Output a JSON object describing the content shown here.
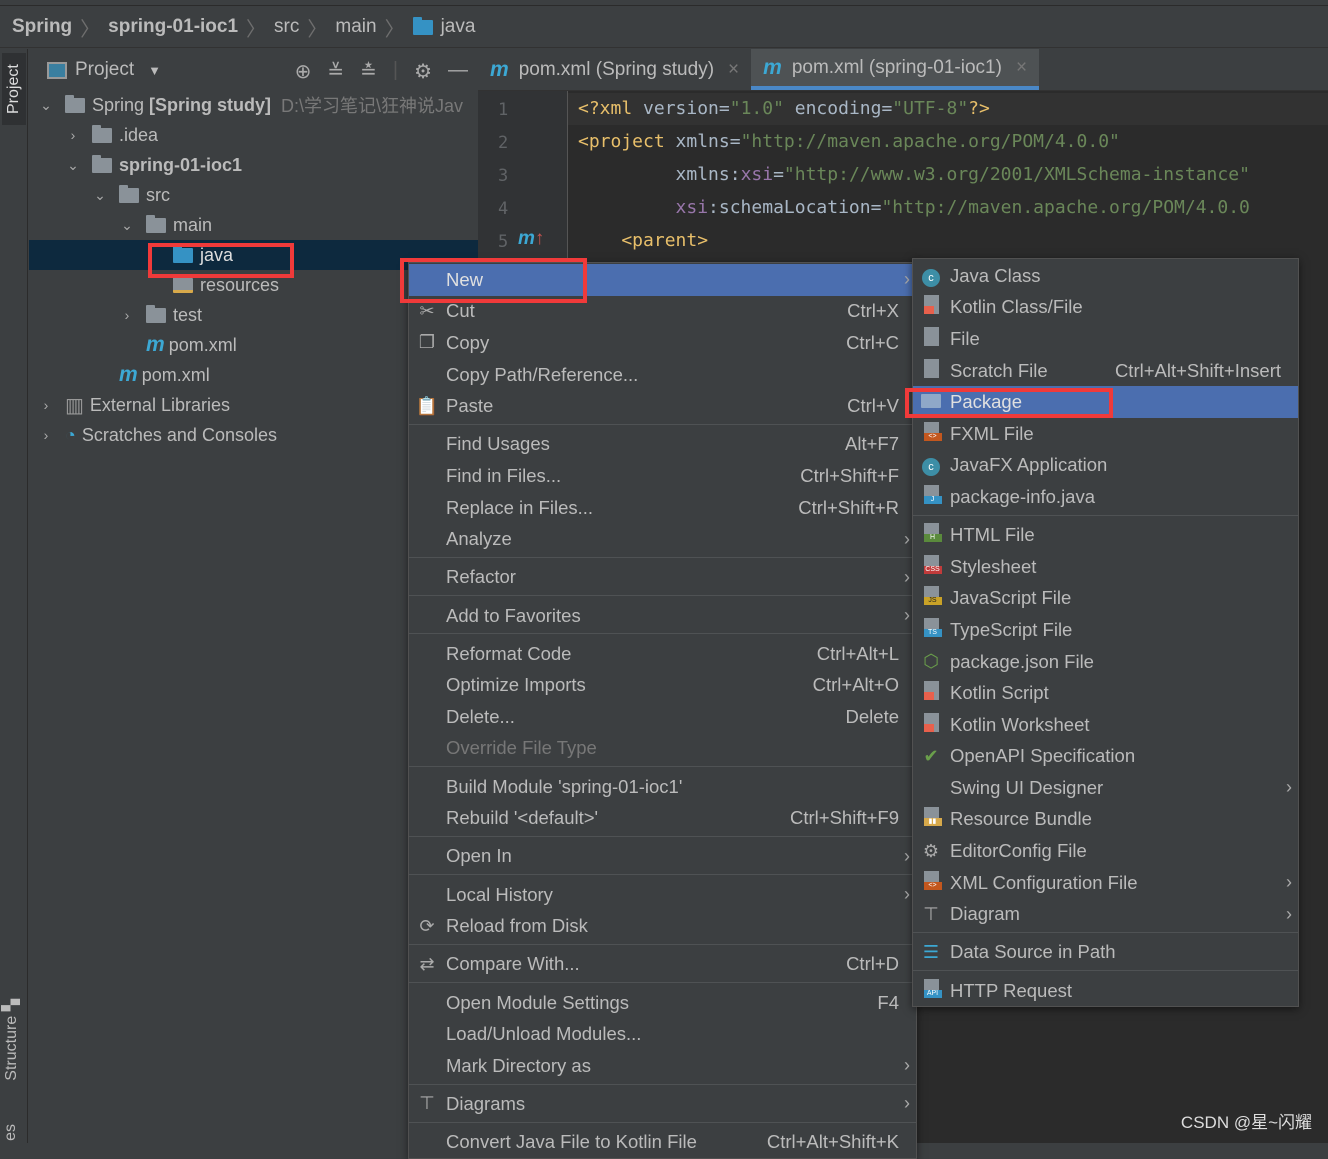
{
  "breadcrumb": [
    "Spring",
    "spring-01-ioc1",
    "src",
    "main",
    "java"
  ],
  "side_tabs": {
    "project": "Project",
    "structure": "Structure",
    "bottom": "es"
  },
  "panel": {
    "title": "Project",
    "toolbar_icons": [
      "locate-icon",
      "expand-all-icon",
      "collapse-all-icon",
      "gear-icon",
      "minimize-icon"
    ]
  },
  "tree": [
    {
      "label": "Spring",
      "bold": "[Spring study]",
      "path": "D:\\学习笔记\\狂神说Jav",
      "chev": "v",
      "icon": "module-folder",
      "indent": 0
    },
    {
      "label": ".idea",
      "chev": ">",
      "icon": "folder",
      "indent": 1
    },
    {
      "label": "spring-01-ioc1",
      "chev": "v",
      "icon": "module-folder",
      "indent": 1,
      "bold_label": true
    },
    {
      "label": "src",
      "chev": "v",
      "icon": "folder",
      "indent": 2
    },
    {
      "label": "main",
      "chev": "v",
      "icon": "folder",
      "indent": 3
    },
    {
      "label": "java",
      "icon": "source-folder",
      "indent": 4,
      "selected": true
    },
    {
      "label": "resources",
      "icon": "resources-folder",
      "indent": 4
    },
    {
      "label": "test",
      "chev": ">",
      "icon": "folder",
      "indent": 3
    },
    {
      "label": "pom.xml",
      "icon": "maven",
      "indent": 3
    },
    {
      "label": "pom.xml",
      "icon": "maven",
      "indent": 2
    },
    {
      "label": "External Libraries",
      "chev": ">",
      "icon": "libraries",
      "indent": 0
    },
    {
      "label": "Scratches and Consoles",
      "chev": ">",
      "icon": "scratches",
      "indent": 0
    }
  ],
  "editor": {
    "tabs": [
      {
        "label": "pom.xml (Spring study)",
        "active": false
      },
      {
        "label": "pom.xml (spring-01-ioc1)",
        "active": true
      }
    ],
    "line_numbers": [
      "1",
      "2",
      "3",
      "4",
      "5"
    ],
    "lines": [
      [
        [
          "t",
          "<?xml "
        ],
        [
          "a",
          "version="
        ],
        [
          "s",
          "\"1.0\""
        ],
        [
          "a",
          " encoding="
        ],
        [
          "s",
          "\"UTF-8\""
        ],
        [
          "t",
          "?>"
        ]
      ],
      [
        [
          "t",
          "<project "
        ],
        [
          "a",
          "xmlns="
        ],
        [
          "s",
          "\"http://maven.apache.org/POM/4.0.0\""
        ]
      ],
      [
        [
          "a",
          "         xmlns:"
        ],
        [
          "n",
          "xsi"
        ],
        [
          "a",
          "="
        ],
        [
          "s",
          "\"http://www.w3.org/2001/XMLSchema-instance\""
        ]
      ],
      [
        [
          "n",
          "         xsi"
        ],
        [
          "a",
          ":schemaLocation="
        ],
        [
          "s",
          "\"http://maven.apache.org/POM/4.0.0"
        ]
      ],
      [
        [
          "t",
          "    <parent>"
        ]
      ]
    ]
  },
  "context_menu": [
    {
      "label": "New",
      "arrow": true,
      "highlight": true
    },
    {
      "label": "Cut",
      "shortcut": "Ctrl+X",
      "icon": "cut-icon"
    },
    {
      "label": "Copy",
      "shortcut": "Ctrl+C",
      "icon": "copy-icon"
    },
    {
      "label": "Copy Path/Reference..."
    },
    {
      "label": "Paste",
      "shortcut": "Ctrl+V",
      "icon": "paste-icon"
    },
    {
      "sep": true
    },
    {
      "label": "Find Usages",
      "shortcut": "Alt+F7"
    },
    {
      "label": "Find in Files...",
      "shortcut": "Ctrl+Shift+F"
    },
    {
      "label": "Replace in Files...",
      "shortcut": "Ctrl+Shift+R"
    },
    {
      "label": "Analyze",
      "arrow": true
    },
    {
      "sep": true
    },
    {
      "label": "Refactor",
      "arrow": true
    },
    {
      "sep": true
    },
    {
      "label": "Add to Favorites",
      "arrow": true
    },
    {
      "sep": true
    },
    {
      "label": "Reformat Code",
      "shortcut": "Ctrl+Alt+L"
    },
    {
      "label": "Optimize Imports",
      "shortcut": "Ctrl+Alt+O"
    },
    {
      "label": "Delete...",
      "shortcut": "Delete"
    },
    {
      "label": "Override File Type",
      "disabled": true
    },
    {
      "sep": true
    },
    {
      "label": "Build Module 'spring-01-ioc1'"
    },
    {
      "label": "Rebuild '<default>'",
      "shortcut": "Ctrl+Shift+F9"
    },
    {
      "sep": true
    },
    {
      "label": "Open In",
      "arrow": true
    },
    {
      "sep": true
    },
    {
      "label": "Local History",
      "arrow": true
    },
    {
      "label": "Reload from Disk",
      "icon": "reload-icon"
    },
    {
      "sep": true
    },
    {
      "label": "Compare With...",
      "shortcut": "Ctrl+D",
      "icon": "compare-icon"
    },
    {
      "sep": true
    },
    {
      "label": "Open Module Settings",
      "shortcut": "F4"
    },
    {
      "label": "Load/Unload Modules..."
    },
    {
      "label": "Mark Directory as",
      "arrow": true
    },
    {
      "sep": true
    },
    {
      "label": "Diagrams",
      "arrow": true,
      "icon": "diagram-icon"
    },
    {
      "sep": true
    },
    {
      "label": "Convert Java File to Kotlin File",
      "shortcut": "Ctrl+Alt+Shift+K"
    }
  ],
  "new_submenu": [
    {
      "label": "Java Class",
      "icon": "java-class-icon"
    },
    {
      "label": "Kotlin Class/File",
      "icon": "kotlin-file-icon"
    },
    {
      "label": "File",
      "icon": "file-icon"
    },
    {
      "label": "Scratch File",
      "shortcut": "Ctrl+Alt+Shift+Insert",
      "icon": "scratch-file-icon"
    },
    {
      "label": "Package",
      "icon": "package-icon",
      "highlight": true
    },
    {
      "label": "FXML File",
      "icon": "fxml-file-icon"
    },
    {
      "label": "JavaFX Application",
      "icon": "javafx-class-icon"
    },
    {
      "label": "package-info.java",
      "icon": "package-info-icon"
    },
    {
      "sep": true
    },
    {
      "label": "HTML File",
      "icon": "html-file-icon"
    },
    {
      "label": "Stylesheet",
      "icon": "css-file-icon"
    },
    {
      "label": "JavaScript File",
      "icon": "js-file-icon"
    },
    {
      "label": "TypeScript File",
      "icon": "ts-file-icon"
    },
    {
      "label": "package.json File",
      "icon": "nodejs-icon"
    },
    {
      "label": "Kotlin Script",
      "icon": "kotlin-script-icon"
    },
    {
      "label": "Kotlin Worksheet",
      "icon": "kotlin-worksheet-icon"
    },
    {
      "label": "OpenAPI Specification",
      "icon": "openapi-icon"
    },
    {
      "label": "Swing UI Designer",
      "arrow": true
    },
    {
      "label": "Resource Bundle",
      "icon": "resource-bundle-icon"
    },
    {
      "label": "EditorConfig File",
      "icon": "editorconfig-icon"
    },
    {
      "label": "XML Configuration File",
      "arrow": true,
      "icon": "xml-file-icon"
    },
    {
      "label": "Diagram",
      "arrow": true,
      "icon": "diagram-icon"
    },
    {
      "sep": true
    },
    {
      "label": "Data Source in Path",
      "icon": "database-icon"
    },
    {
      "sep": true
    },
    {
      "label": "HTTP Request",
      "icon": "api-file-icon"
    }
  ],
  "watermark": "CSDN @星~闪耀",
  "colors": {
    "highlight": "#4b6eaf",
    "selection": "#0d293e",
    "annotation_box": "#f03a3a",
    "tab_underline": "#4a88c7"
  }
}
